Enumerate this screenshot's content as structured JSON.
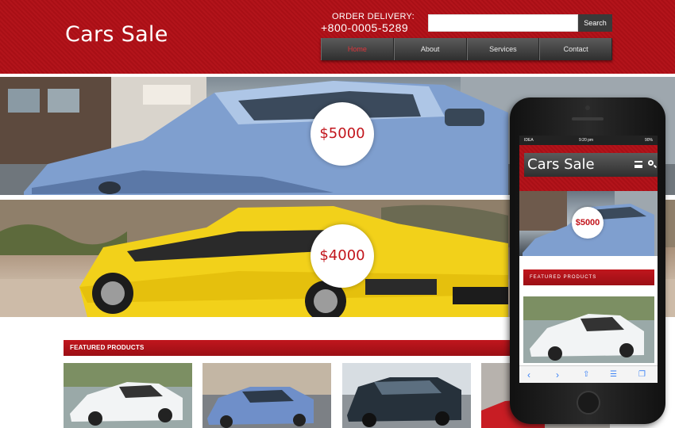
{
  "header": {
    "logo": "Cars Sale",
    "delivery_label": "ORDER DELIVERY:",
    "delivery_phone": "+800-0005-5289",
    "search_placeholder": "",
    "search_button": "Search"
  },
  "nav": {
    "items": [
      {
        "label": "Home",
        "active": true
      },
      {
        "label": "About",
        "active": false
      },
      {
        "label": "Services",
        "active": false
      },
      {
        "label": "Contact",
        "active": false
      }
    ]
  },
  "slides": [
    {
      "price": "$5000",
      "car_color": "#7f9fcf"
    },
    {
      "price": "$4000",
      "car_color": "#f2d11a"
    }
  ],
  "featured": {
    "title": "FEATURED PRODUCTS",
    "thumbs": [
      {
        "car_color": "#f2f4f5"
      },
      {
        "car_color": "#6f8fc9"
      },
      {
        "car_color": "#26313b"
      },
      {
        "car_color": "#c81d24"
      }
    ]
  },
  "phone": {
    "status_carrier": "IDEA",
    "status_time": "9:20 pm",
    "status_battery": "90%",
    "logo": "Cars Sale",
    "price": "$5000",
    "featured_title": "FEATURED PRODUCTS",
    "toolbar_icons": [
      "back-icon",
      "forward-icon",
      "share-icon",
      "bookmarks-icon",
      "tabs-icon"
    ]
  },
  "colors": {
    "brand_red": "#b3141b",
    "nav_dark": "#3a3a3a",
    "nav_active": "#e0343b"
  }
}
